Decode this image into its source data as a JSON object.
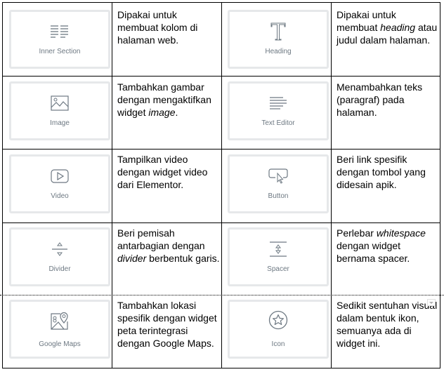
{
  "rows": [
    {
      "left": {
        "widget_label": "Inner Section",
        "icon": "inner-section-icon",
        "desc": [
          "Dipakai untuk membuat kolom di halaman web."
        ]
      },
      "right": {
        "widget_label": "Heading",
        "icon": "heading-icon",
        "desc_pre": "Dipakai untuk membuat ",
        "desc_em": "heading",
        "desc_post": " atau judul dalam halaman."
      }
    },
    {
      "left": {
        "widget_label": "Image",
        "icon": "image-icon",
        "desc_pre": "Tambahkan gambar dengan mengaktifkan widget ",
        "desc_em": "image",
        "desc_post": "."
      },
      "right": {
        "widget_label": "Text Editor",
        "icon": "text-editor-icon",
        "desc": "Menambahkan teks (paragraf) pada halaman."
      }
    },
    {
      "left": {
        "widget_label": "Video",
        "icon": "video-icon",
        "desc": "Tampilkan video dengan widget video dari Elementor."
      },
      "right": {
        "widget_label": "Button",
        "icon": "button-icon",
        "desc": "Beri link spesifik dengan tombol yang didesain apik."
      }
    },
    {
      "left": {
        "widget_label": "Divider",
        "icon": "divider-icon",
        "desc_pre": "Beri pemisah antarbagian dengan ",
        "desc_em": "divider",
        "desc_post": " berbentuk garis."
      },
      "right": {
        "widget_label": "Spacer",
        "icon": "spacer-icon",
        "desc_pre": "Perlebar ",
        "desc_em": "whitespace",
        "desc_post": " dengan widget bernama spacer."
      }
    },
    {
      "left": {
        "widget_label": "Google Maps",
        "icon": "google-maps-icon",
        "desc": "Tambahkan lokasi spesifik dengan widget peta terintegrasi dengan Google Maps."
      },
      "right": {
        "widget_label": "Icon",
        "icon": "star-icon",
        "desc": "Sedikit sentuhan visual dalam bentuk ikon, semuanya ada di widget ini."
      }
    }
  ],
  "colors": {
    "border": "#000000",
    "card_border": "#e6e8ea",
    "card_label": "#6d7882",
    "icon_stroke": "#6d7882"
  }
}
